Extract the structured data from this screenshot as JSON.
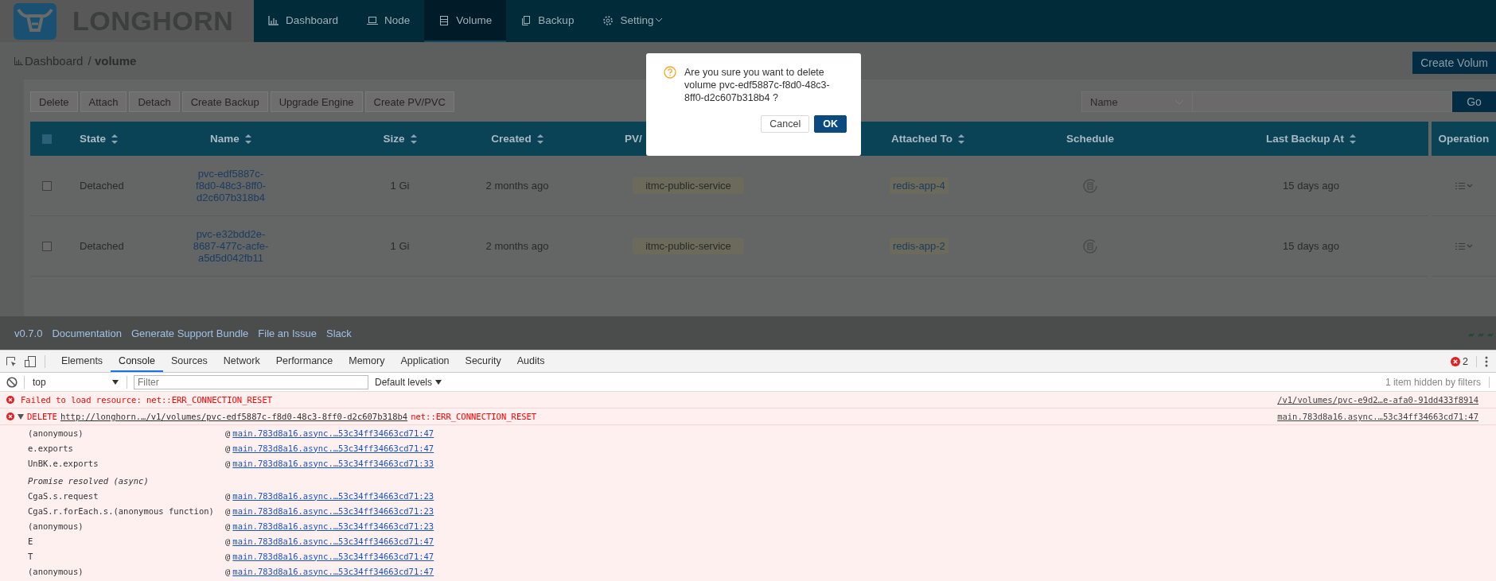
{
  "app": {
    "logo": "LONGHORN",
    "nav": [
      {
        "label": "Dashboard",
        "selected": false,
        "dropdown": false
      },
      {
        "label": "Node",
        "selected": false,
        "dropdown": false
      },
      {
        "label": "Volume",
        "selected": true,
        "dropdown": false
      },
      {
        "label": "Backup",
        "selected": false,
        "dropdown": false
      },
      {
        "label": "Setting",
        "selected": false,
        "dropdown": true
      }
    ],
    "breadcrumb": {
      "parent": "Dashboard",
      "separator": "/",
      "current": "volume"
    },
    "create_button": "Create Volum",
    "actions": [
      "Delete",
      "Attach",
      "Detach",
      "Create Backup",
      "Upgrade Engine",
      "Create PV/PVC"
    ],
    "search": {
      "field": "Name",
      "button": "Go"
    },
    "table": {
      "all_checked": false,
      "columns": [
        {
          "label": "State",
          "sortable": true
        },
        {
          "label": "Name",
          "sortable": true
        },
        {
          "label": "Size",
          "sortable": true
        },
        {
          "label": "Created",
          "sortable": true
        },
        {
          "label": "PV/",
          "sortable": false
        },
        {
          "label": "Attached To",
          "sortable": true
        },
        {
          "label": "Schedule",
          "sortable": false
        },
        {
          "label": "Last Backup At",
          "sortable": true
        },
        {
          "label": "Operation",
          "sortable": false
        }
      ],
      "rows": [
        {
          "checked": false,
          "state": "Detached",
          "name": "pvc-edf5887c-f8d0-48c3-8ff0-d2c607b318b4",
          "size": "1 Gi",
          "created": "2 months ago",
          "pv": "itmc-public-service",
          "attached_to": "redis-app-4",
          "last_backup": "15 days ago"
        },
        {
          "checked": false,
          "state": "Detached",
          "name": "pvc-e32bdd2e-8687-477c-acfe-a5d5d042fb11",
          "size": "1 Gi",
          "created": "2 months ago",
          "pv": "itmc-public-service",
          "attached_to": "redis-app-2",
          "last_backup": "15 days ago"
        }
      ]
    },
    "footer": {
      "version": "v0.7.0",
      "links": [
        "Documentation",
        "Generate Support Bundle",
        "File an Issue",
        "Slack"
      ]
    }
  },
  "dialog": {
    "message": "Are you sure you want to delete volume pvc-edf5887c-f8d0-48c3-8ff0-d2c607b318b4 ?",
    "buttons": [
      {
        "label": "Cancel",
        "kind": "default"
      },
      {
        "label": "OK",
        "kind": "primary"
      }
    ]
  },
  "devtools": {
    "tabs": [
      {
        "label": "Elements",
        "selected": false
      },
      {
        "label": "Console",
        "selected": true
      },
      {
        "label": "Sources",
        "selected": false
      },
      {
        "label": "Network",
        "selected": false
      },
      {
        "label": "Performance",
        "selected": false
      },
      {
        "label": "Memory",
        "selected": false
      },
      {
        "label": "Application",
        "selected": false
      },
      {
        "label": "Security",
        "selected": false
      },
      {
        "label": "Audits",
        "selected": false
      }
    ],
    "error_count": "2",
    "context": "top",
    "filter": {
      "placeholder": "Filter"
    },
    "levels": "Default levels",
    "hidden_note": "1 item hidden by filters",
    "messages": [
      {
        "kind": "plain",
        "text": "Failed to load resource: net::ERR_CONNECTION_RESET",
        "source": "/v1/volumes/pvc-e9d2…e-afa0-91dd433f8914"
      },
      {
        "kind": "request",
        "expanded": true,
        "method": "DELETE",
        "url": "http://longhorn.…/v1/volumes/pvc-edf5887c-f8d0-48c3-8ff0-d2c607b318b4",
        "status": "net::ERR_CONNECTION_RESET",
        "source": "main.783d8a16.async.…53c34ff34663cd71:47"
      }
    ],
    "stack": [
      {
        "kind": "frame",
        "fn": "(anonymous)",
        "at": "@",
        "link": "main.783d8a16.async.…53c34ff34663cd71:47"
      },
      {
        "kind": "frame",
        "fn": "e.exports",
        "at": "@",
        "link": "main.783d8a16.async.…53c34ff34663cd71:47"
      },
      {
        "kind": "frame",
        "fn": "UnBK.e.exports",
        "at": "@",
        "link": "main.783d8a16.async.…53c34ff34663cd71:33"
      },
      {
        "kind": "async",
        "text": "Promise resolved (async)"
      },
      {
        "kind": "frame",
        "fn": "CgaS.s.request",
        "at": "@",
        "link": "main.783d8a16.async.…53c34ff34663cd71:23"
      },
      {
        "kind": "frame",
        "fn": "CgaS.r.forEach.s.(anonymous function)",
        "at": "@",
        "link": "main.783d8a16.async.…53c34ff34663cd71:23"
      },
      {
        "kind": "frame",
        "fn": "(anonymous)",
        "at": "@",
        "link": "main.783d8a16.async.…53c34ff34663cd71:23"
      },
      {
        "kind": "frame",
        "fn": "E",
        "at": "@",
        "link": "main.783d8a16.async.…53c34ff34663cd71:47"
      },
      {
        "kind": "frame",
        "fn": "T",
        "at": "@",
        "link": "main.783d8a16.async.…53c34ff34663cd71:47"
      },
      {
        "kind": "frame",
        "fn": "(anonymous)",
        "at": "@",
        "link": "main.783d8a16.async.…53c34ff34663cd71:47"
      }
    ]
  }
}
